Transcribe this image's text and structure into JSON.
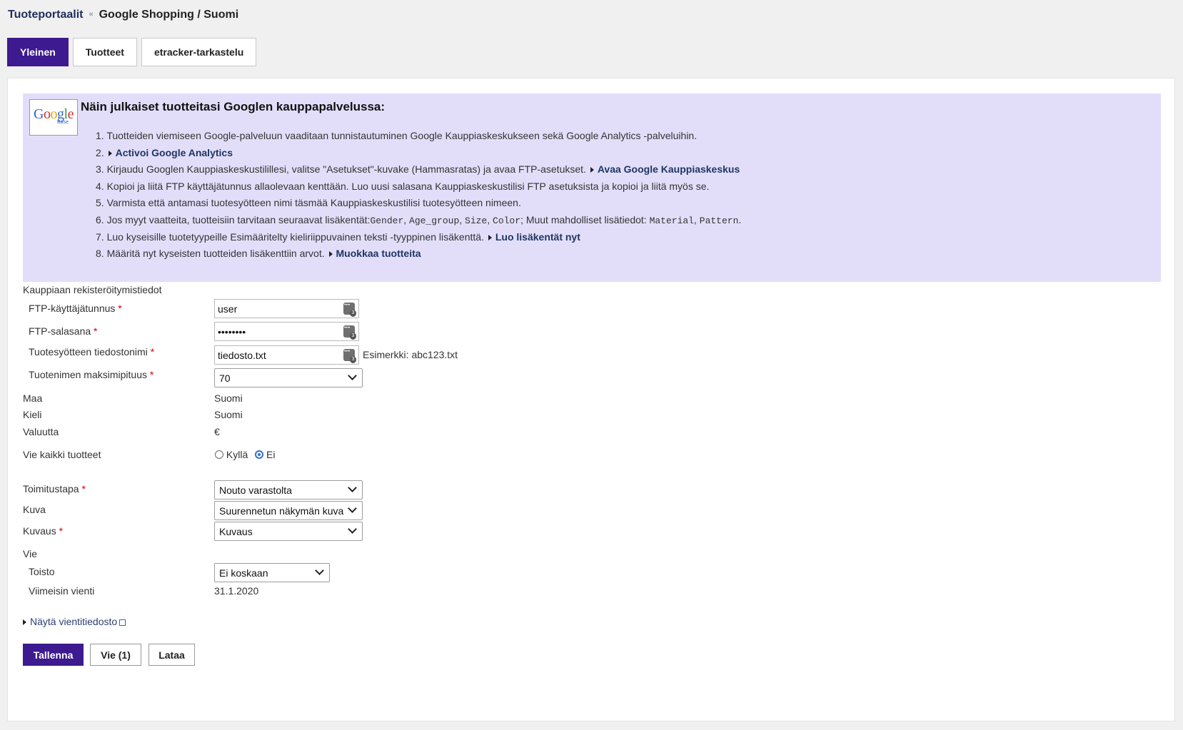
{
  "breadcrumb": {
    "parent": "Tuoteportaalit",
    "separator": "«",
    "current": "Google Shopping / Suomi"
  },
  "tabs": [
    {
      "label": "Yleinen",
      "active": true
    },
    {
      "label": "Tuotteet",
      "active": false
    },
    {
      "label": "etracker-tarkastelu",
      "active": false
    }
  ],
  "info": {
    "logo_text": "Google",
    "logo_sub": "Base",
    "title": "Näin julkaiset tuotteitasi Googlen kauppapalvelussa:",
    "steps": [
      {
        "num": "1.",
        "text": "Tuotteiden viemiseen Google-palveluun vaaditaan tunnistautuminen Google Kauppiaskeskukseen sekä Google Analytics -palveluihin."
      },
      {
        "num": "2.",
        "link": "Activoi Google Analytics"
      },
      {
        "num": "3.",
        "text": "Kirjaudu Googlen Kauppiaskeskustilillesi, valitse \"Asetukset\"-kuvake (Hammasratas) ja avaa FTP-asetukset.",
        "link": "Avaa Google Kauppiaskeskus"
      },
      {
        "num": "4.",
        "text": "Kopioi ja liitä FTP käyttäjätunnus allaolevaan kenttään. Luo uusi salasana Kauppiaskeskustilisi FTP asetuksista ja kopioi ja liitä myös se."
      },
      {
        "num": "5.",
        "text": "Varmista että antamasi tuotesyötteen nimi täsmää Kauppiaskeskustilisi tuotesyötteen nimeen."
      },
      {
        "num": "6.",
        "text_a": "Jos myyt vaatteita, tuotteisiin tarvitaan seuraavat lisäkentät:",
        "codes_a": [
          "Gender",
          "Age_group",
          "Size",
          "Color"
        ],
        "text_b": "; Muut mahdolliset lisätiedot: ",
        "codes_b": [
          "Material",
          "Pattern"
        ],
        "text_c": "."
      },
      {
        "num": "7.",
        "text": "Luo kyseisille tuotetyypeille Esimääritelty kieliriippuvainen teksti -tyyppinen lisäkenttä.",
        "link": "Luo lisäkentät nyt"
      },
      {
        "num": "8.",
        "text": "Määritä nyt kyseisten tuotteiden lisäkenttiin arvot.",
        "link": "Muokkaa tuotteita"
      }
    ]
  },
  "form": {
    "section_title": "Kauppiaan rekisteröitymistiedot",
    "required_mark": "*",
    "ftp_user": {
      "label": "FTP-käyttäjätunnus",
      "value": "user",
      "icon": "password-manager-icon"
    },
    "ftp_password": {
      "label": "FTP-salasana",
      "value": "••••••••",
      "icon": "password-manager-icon"
    },
    "feed_filename": {
      "label": "Tuotesyötteen tiedostonimi",
      "value": "tiedosto.txt",
      "hint": "Esimerkki: abc123.txt",
      "icon": "password-manager-icon"
    },
    "max_name_length": {
      "label": "Tuotenimen maksimipituus",
      "value": "70"
    },
    "country": {
      "label": "Maa",
      "value": "Suomi"
    },
    "language": {
      "label": "Kieli",
      "value": "Suomi"
    },
    "currency": {
      "label": "Valuutta",
      "value": "€"
    },
    "export_all": {
      "label": "Vie kaikki tuotteet",
      "yes": "Kyllä",
      "no": "Ei",
      "selected": "Ei"
    },
    "delivery": {
      "label": "Toimitustapa",
      "value": "Nouto varastolta"
    },
    "image": {
      "label": "Kuva",
      "value": "Suurennetun näkymän kuva"
    },
    "description": {
      "label": "Kuvaus",
      "value": "Kuvaus"
    },
    "export_section": "Vie",
    "repeat": {
      "label": "Toisto",
      "value": "Ei koskaan"
    },
    "last_export": {
      "label": "Viimeisin vienti",
      "value": "31.1.2020"
    },
    "show_export_file": "Näytä vientitiedosto"
  },
  "buttons": {
    "save": "Tallenna",
    "export": "Vie (1)",
    "download": "Lataa"
  },
  "colors": {
    "accent": "#3d1a8f",
    "info_bg": "#e2defa",
    "link": "#1f3563"
  }
}
